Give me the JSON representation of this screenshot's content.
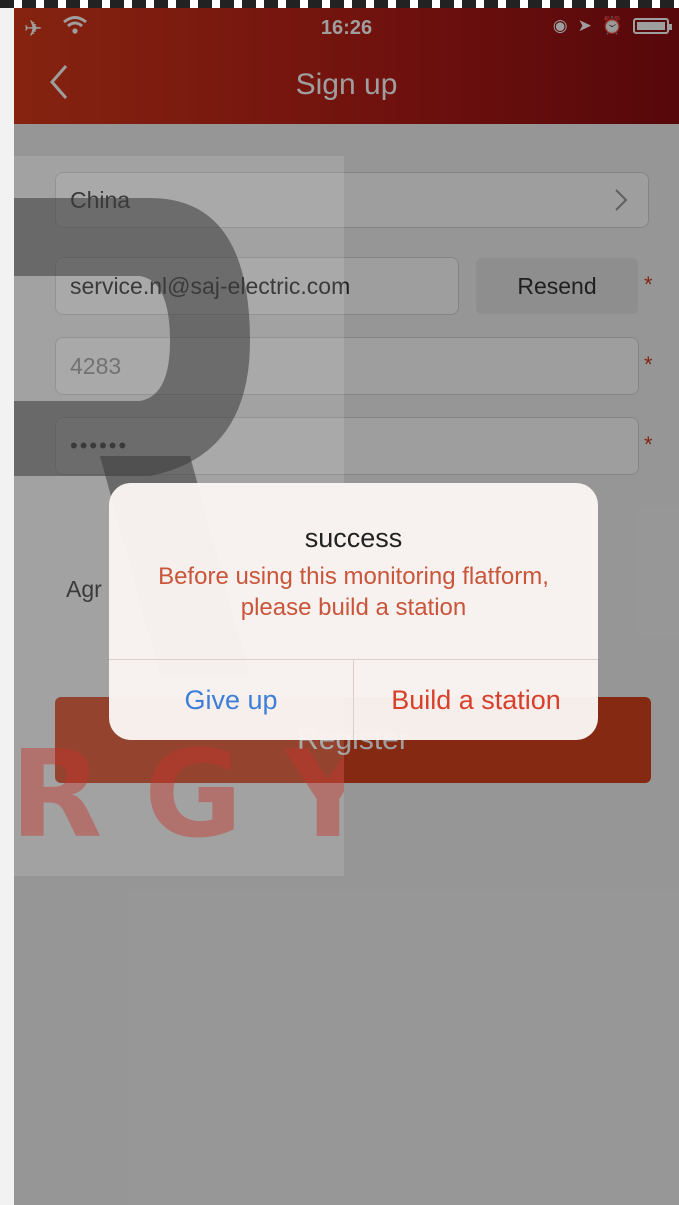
{
  "status_bar": {
    "time": "16:26"
  },
  "header": {
    "title": "Sign up"
  },
  "form": {
    "country": "China",
    "email": "service.nl@saj-electric.com",
    "resend_label": "Resend",
    "code": "4283",
    "password": "••••••",
    "asterisk": "*",
    "agree_text": "Agr",
    "register_label": "Register"
  },
  "alert": {
    "title": "success",
    "message": "Before using this monitoring flatform, please build a station",
    "cancel_label": "Give up",
    "confirm_label": "Build a station"
  },
  "colors": {
    "header_start": "#d83a1a",
    "header_end": "#8c0d12",
    "accent_red": "#d8402b",
    "link_blue": "#3d7fd8"
  },
  "icons": [
    "airplane-icon",
    "wifi-icon",
    "orientation-lock-icon",
    "location-icon",
    "alarm-icon",
    "battery-icon",
    "back-chevron-icon",
    "chevron-right-icon"
  ]
}
